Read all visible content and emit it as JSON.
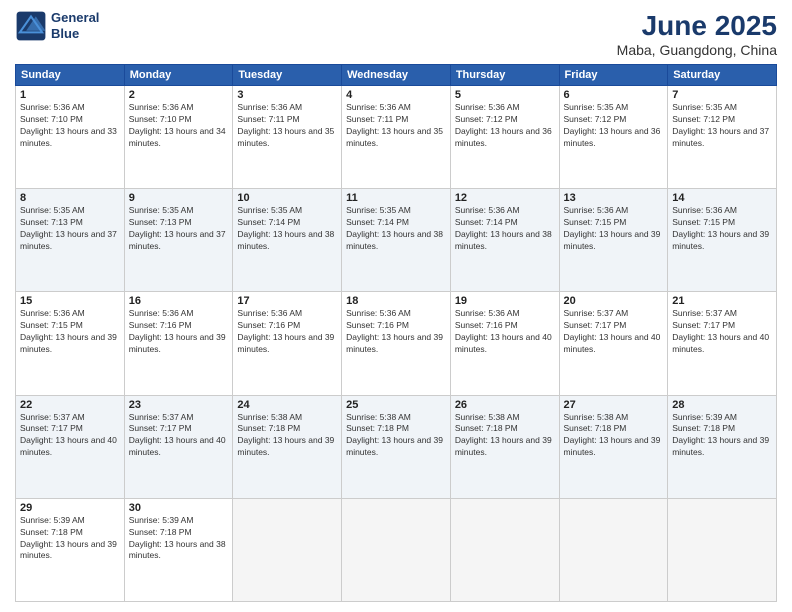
{
  "header": {
    "logo_line1": "General",
    "logo_line2": "Blue",
    "month": "June 2025",
    "location": "Maba, Guangdong, China"
  },
  "weekdays": [
    "Sunday",
    "Monday",
    "Tuesday",
    "Wednesday",
    "Thursday",
    "Friday",
    "Saturday"
  ],
  "weeks": [
    [
      {
        "day": "1",
        "sunrise": "5:36 AM",
        "sunset": "7:10 PM",
        "daylight": "13 hours and 33 minutes."
      },
      {
        "day": "2",
        "sunrise": "5:36 AM",
        "sunset": "7:10 PM",
        "daylight": "13 hours and 34 minutes."
      },
      {
        "day": "3",
        "sunrise": "5:36 AM",
        "sunset": "7:11 PM",
        "daylight": "13 hours and 35 minutes."
      },
      {
        "day": "4",
        "sunrise": "5:36 AM",
        "sunset": "7:11 PM",
        "daylight": "13 hours and 35 minutes."
      },
      {
        "day": "5",
        "sunrise": "5:36 AM",
        "sunset": "7:12 PM",
        "daylight": "13 hours and 36 minutes."
      },
      {
        "day": "6",
        "sunrise": "5:35 AM",
        "sunset": "7:12 PM",
        "daylight": "13 hours and 36 minutes."
      },
      {
        "day": "7",
        "sunrise": "5:35 AM",
        "sunset": "7:12 PM",
        "daylight": "13 hours and 37 minutes."
      }
    ],
    [
      {
        "day": "8",
        "sunrise": "5:35 AM",
        "sunset": "7:13 PM",
        "daylight": "13 hours and 37 minutes."
      },
      {
        "day": "9",
        "sunrise": "5:35 AM",
        "sunset": "7:13 PM",
        "daylight": "13 hours and 37 minutes."
      },
      {
        "day": "10",
        "sunrise": "5:35 AM",
        "sunset": "7:14 PM",
        "daylight": "13 hours and 38 minutes."
      },
      {
        "day": "11",
        "sunrise": "5:35 AM",
        "sunset": "7:14 PM",
        "daylight": "13 hours and 38 minutes."
      },
      {
        "day": "12",
        "sunrise": "5:36 AM",
        "sunset": "7:14 PM",
        "daylight": "13 hours and 38 minutes."
      },
      {
        "day": "13",
        "sunrise": "5:36 AM",
        "sunset": "7:15 PM",
        "daylight": "13 hours and 39 minutes."
      },
      {
        "day": "14",
        "sunrise": "5:36 AM",
        "sunset": "7:15 PM",
        "daylight": "13 hours and 39 minutes."
      }
    ],
    [
      {
        "day": "15",
        "sunrise": "5:36 AM",
        "sunset": "7:15 PM",
        "daylight": "13 hours and 39 minutes."
      },
      {
        "day": "16",
        "sunrise": "5:36 AM",
        "sunset": "7:16 PM",
        "daylight": "13 hours and 39 minutes."
      },
      {
        "day": "17",
        "sunrise": "5:36 AM",
        "sunset": "7:16 PM",
        "daylight": "13 hours and 39 minutes."
      },
      {
        "day": "18",
        "sunrise": "5:36 AM",
        "sunset": "7:16 PM",
        "daylight": "13 hours and 39 minutes."
      },
      {
        "day": "19",
        "sunrise": "5:36 AM",
        "sunset": "7:16 PM",
        "daylight": "13 hours and 40 minutes."
      },
      {
        "day": "20",
        "sunrise": "5:37 AM",
        "sunset": "7:17 PM",
        "daylight": "13 hours and 40 minutes."
      },
      {
        "day": "21",
        "sunrise": "5:37 AM",
        "sunset": "7:17 PM",
        "daylight": "13 hours and 40 minutes."
      }
    ],
    [
      {
        "day": "22",
        "sunrise": "5:37 AM",
        "sunset": "7:17 PM",
        "daylight": "13 hours and 40 minutes."
      },
      {
        "day": "23",
        "sunrise": "5:37 AM",
        "sunset": "7:17 PM",
        "daylight": "13 hours and 40 minutes."
      },
      {
        "day": "24",
        "sunrise": "5:38 AM",
        "sunset": "7:18 PM",
        "daylight": "13 hours and 39 minutes."
      },
      {
        "day": "25",
        "sunrise": "5:38 AM",
        "sunset": "7:18 PM",
        "daylight": "13 hours and 39 minutes."
      },
      {
        "day": "26",
        "sunrise": "5:38 AM",
        "sunset": "7:18 PM",
        "daylight": "13 hours and 39 minutes."
      },
      {
        "day": "27",
        "sunrise": "5:38 AM",
        "sunset": "7:18 PM",
        "daylight": "13 hours and 39 minutes."
      },
      {
        "day": "28",
        "sunrise": "5:39 AM",
        "sunset": "7:18 PM",
        "daylight": "13 hours and 39 minutes."
      }
    ],
    [
      {
        "day": "29",
        "sunrise": "5:39 AM",
        "sunset": "7:18 PM",
        "daylight": "13 hours and 39 minutes."
      },
      {
        "day": "30",
        "sunrise": "5:39 AM",
        "sunset": "7:18 PM",
        "daylight": "13 hours and 38 minutes."
      },
      null,
      null,
      null,
      null,
      null
    ]
  ]
}
